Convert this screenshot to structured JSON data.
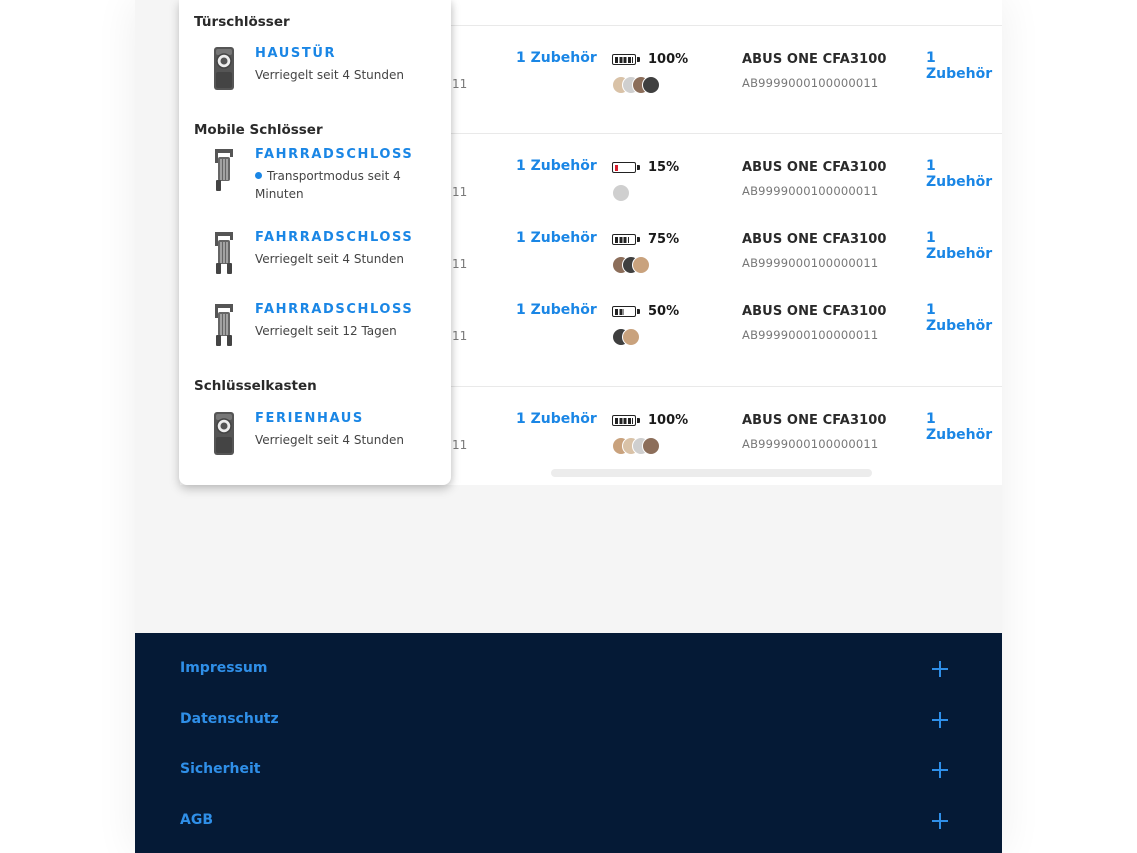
{
  "rows": [
    {
      "id_suffix": "11",
      "accessory_left": "1 Zubehör",
      "battery_pct": 100,
      "battery_label": "100%",
      "model": "ABUS ONE CFA3100",
      "serial": "AB9999000100000011",
      "accessory_right": "1 Zubehör",
      "avatar_count": 4
    },
    {
      "id_suffix": "11",
      "accessory_left": "1 Zubehör",
      "battery_pct": 15,
      "battery_label": "15%",
      "model": "ABUS ONE CFA3100",
      "serial": "AB9999000100000011",
      "accessory_right": "1 Zubehör",
      "avatar_count": 1
    },
    {
      "id_suffix": "11",
      "accessory_left": "1 Zubehör",
      "battery_pct": 75,
      "battery_label": "75%",
      "model": "ABUS ONE CFA3100",
      "serial": "AB9999000100000011",
      "accessory_right": "1 Zubehör",
      "avatar_count": 3
    },
    {
      "id_suffix": "11",
      "accessory_left": "1 Zubehör",
      "battery_pct": 50,
      "battery_label": "50%",
      "model": "ABUS ONE CFA3100",
      "serial": "AB9999000100000011",
      "accessory_right": "1 Zubehör",
      "avatar_count": 2
    },
    {
      "id_suffix": "11",
      "accessory_left": "1 Zubehör",
      "battery_pct": 100,
      "battery_label": "100%",
      "model": "ABUS ONE CFA3100",
      "serial": "AB9999000100000011",
      "accessory_right": "1 Zubehör",
      "avatar_count": 4
    }
  ],
  "dropdown": {
    "groups": [
      {
        "title": "Türschlösser",
        "items": [
          {
            "name": "HAUSTÜR",
            "status": "Verriegelt seit 4 Stunden",
            "icon": "door-lock-icon",
            "transport": false
          }
        ]
      },
      {
        "title": "Mobile Schlösser",
        "items": [
          {
            "name": "FAHRRADSCHLOSS",
            "status": "Transportmodus seit 4 Minuten",
            "icon": "bike-lock-open-icon",
            "transport": true
          },
          {
            "name": "FAHRRADSCHLOSS",
            "status": "Verriegelt seit 4 Stunden",
            "icon": "bike-lock-icon",
            "transport": false
          },
          {
            "name": "FAHRRADSCHLOSS",
            "status": "Verriegelt seit 12 Tagen",
            "icon": "bike-lock-icon",
            "transport": false
          }
        ]
      },
      {
        "title": "Schlüsselkasten",
        "items": [
          {
            "name": "FERIENHAUS",
            "status": "Verriegelt seit 4 Stunden",
            "icon": "key-box-icon",
            "transport": false
          }
        ]
      }
    ]
  },
  "footer": {
    "items": [
      "Impressum",
      "Datenschutz",
      "Sicherheit",
      "AGB"
    ]
  },
  "colors": {
    "accent": "#1a86e5",
    "footer_bg": "#051a36",
    "battery_low": "#d8202f"
  }
}
